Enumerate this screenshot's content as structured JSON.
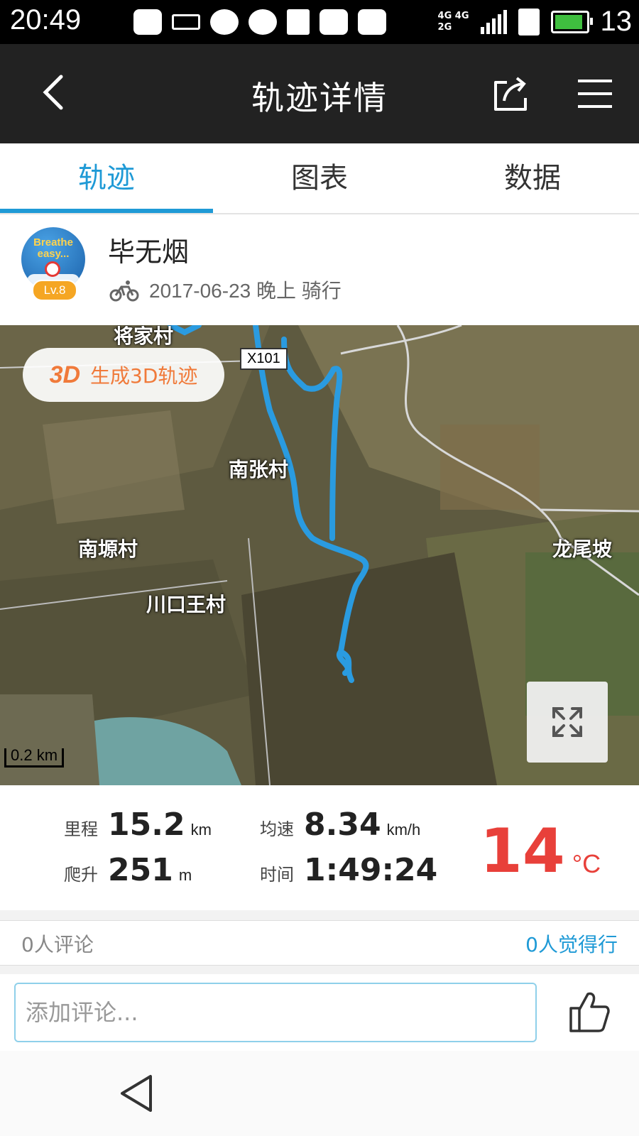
{
  "status_bar": {
    "time": "20:49",
    "network_top": "4G 4G",
    "network_bottom": "2G",
    "battery": "13"
  },
  "header": {
    "title": "轨迹详情"
  },
  "tabs": [
    {
      "label": "轨迹",
      "active": true
    },
    {
      "label": "图表",
      "active": false
    },
    {
      "label": "数据",
      "active": false
    }
  ],
  "user": {
    "avatar_text_1": "Breathe",
    "avatar_text_2": "easy...",
    "level": "Lv.8",
    "name": "毕无烟",
    "meta": "2017-06-23 晚上 骑行"
  },
  "map": {
    "btn3d_icon": "3D",
    "btn3d_label": "生成3D轨迹",
    "road_sign": "X101",
    "labels": {
      "top": "将家村",
      "nanzhang": "南张村",
      "nanyuan": "南塬村",
      "chuankou": "川口王村",
      "longwei": "龙尾坡"
    },
    "scale": "0.2 km"
  },
  "stats": {
    "distance_label": "里程",
    "distance_value": "15.2",
    "distance_unit": "km",
    "speed_label": "均速",
    "speed_value": "8.34",
    "speed_unit": "km/h",
    "climb_label": "爬升",
    "climb_value": "251",
    "climb_unit": "m",
    "time_label": "时间",
    "time_value": "1:49:24",
    "temp_value": "14",
    "temp_unit": "°C"
  },
  "comments": {
    "count": "0人评论",
    "likes": "0人觉得行",
    "input_placeholder": "添加评论..."
  },
  "colors": {
    "accent": "#1f9ad6",
    "temp": "#e8403a",
    "track": "#2a9be0",
    "btn3d": "#f07a3a"
  }
}
